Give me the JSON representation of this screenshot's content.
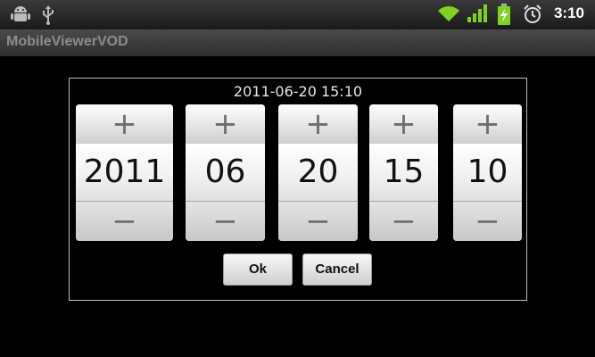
{
  "status_bar": {
    "time": "3:10",
    "icons": [
      "android-debug-icon",
      "usb-icon",
      "wifi-icon",
      "signal-icon",
      "battery-charging-icon",
      "alarm-icon"
    ]
  },
  "app": {
    "title": "MobileViewerVOD"
  },
  "dialog": {
    "title": "2011-06-20   15:10",
    "increment_symbol": "+",
    "decrement_symbol": "−",
    "spinners": [
      {
        "field": "year",
        "value": "2011"
      },
      {
        "field": "month",
        "value": "06"
      },
      {
        "field": "day",
        "value": "20"
      },
      {
        "field": "hour",
        "value": "15"
      },
      {
        "field": "minute",
        "value": "10"
      }
    ],
    "ok_label": "Ok",
    "cancel_label": "Cancel"
  },
  "colors": {
    "background": "#000000",
    "spinner_face": "#f2f2f2",
    "text": "#111111"
  }
}
